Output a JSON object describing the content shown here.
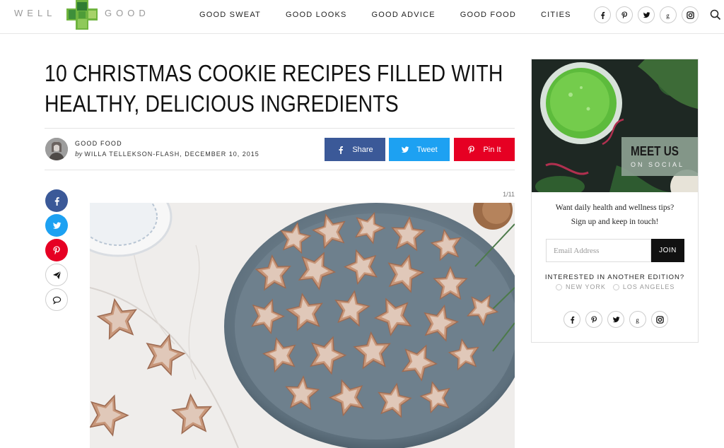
{
  "header": {
    "logo_left": "WELL",
    "logo_right": "GOOD",
    "nav": [
      "GOOD SWEAT",
      "GOOD LOOKS",
      "GOOD ADVICE",
      "GOOD FOOD",
      "CITIES"
    ],
    "social_icons": [
      "facebook-icon",
      "pinterest-icon",
      "twitter-icon",
      "google-plus-icon",
      "instagram-icon"
    ],
    "search_icon": "search-icon"
  },
  "article": {
    "title": "10 CHRISTMAS COOKIE RECIPES FILLED WITH HEALTHY, DELICIOUS INGREDIENTS",
    "title_line1": "10 CHRISTMAS COOKIE RECIPES FILLED WITH",
    "title_line2": "HEALTHY, DELICIOUS INGREDIENTS",
    "category": "GOOD FOOD",
    "by": "by",
    "author_date": "WILLA TELLEKSON-FLASH, DECEMBER 10, 2015",
    "share": {
      "facebook": "Share",
      "twitter": "Tweet",
      "pinterest": "Pin It"
    },
    "slide_counter": "1/11",
    "colors": {
      "facebook": "#3b5998",
      "twitter": "#1da1f2",
      "pinterest": "#e60023"
    }
  },
  "sidebar": {
    "promo_title": "MEET US",
    "promo_sub": "ON SOCIAL",
    "tagline_1": "Want daily health and wellness tips?",
    "tagline_2": "Sign up and keep in touch!",
    "email_placeholder": "Email Address",
    "join_label": "JOIN",
    "edition_question": "INTERESTED IN ANOTHER EDITION?",
    "editions": [
      "NEW YORK",
      "LOS ANGELES"
    ]
  }
}
